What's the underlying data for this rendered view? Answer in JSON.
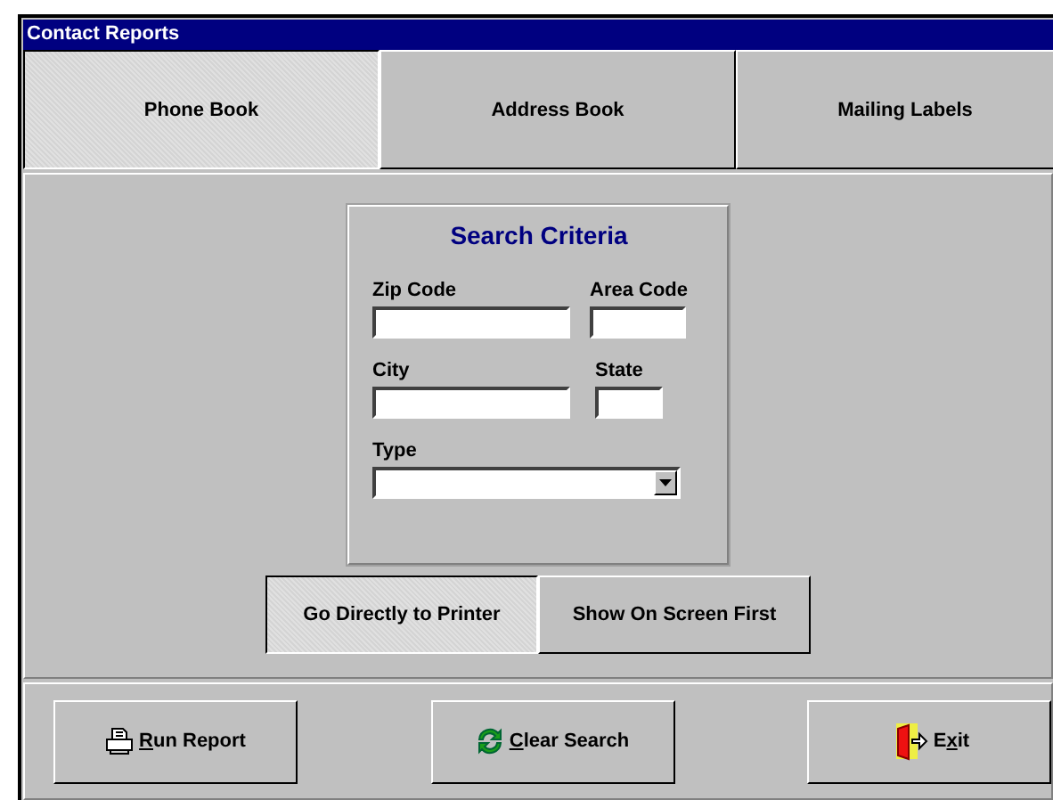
{
  "window": {
    "title": "Contact Reports"
  },
  "tabs": [
    {
      "label": "Phone Book",
      "selected": true
    },
    {
      "label": "Address Book",
      "selected": false
    },
    {
      "label": "Mailing Labels",
      "selected": false
    }
  ],
  "search": {
    "title": "Search Criteria",
    "fields": [
      {
        "label": "Zip Code",
        "kind": "text"
      },
      {
        "label": "Area Code",
        "kind": "text"
      },
      {
        "label": "City",
        "kind": "text"
      },
      {
        "label": "State",
        "kind": "text"
      },
      {
        "label": "Type",
        "kind": "dropdown"
      }
    ]
  },
  "output": [
    {
      "label": "Go Directly to Printer",
      "selected": true
    },
    {
      "label": "Show On Screen First",
      "selected": false
    }
  ],
  "buttons": [
    {
      "kind": "printer",
      "key": "R",
      "after": "un Report"
    },
    {
      "kind": "refresh",
      "key": "C",
      "after": "lear Search"
    },
    {
      "kind": "exit",
      "before": "E",
      "key": "x",
      "after": "it"
    }
  ]
}
